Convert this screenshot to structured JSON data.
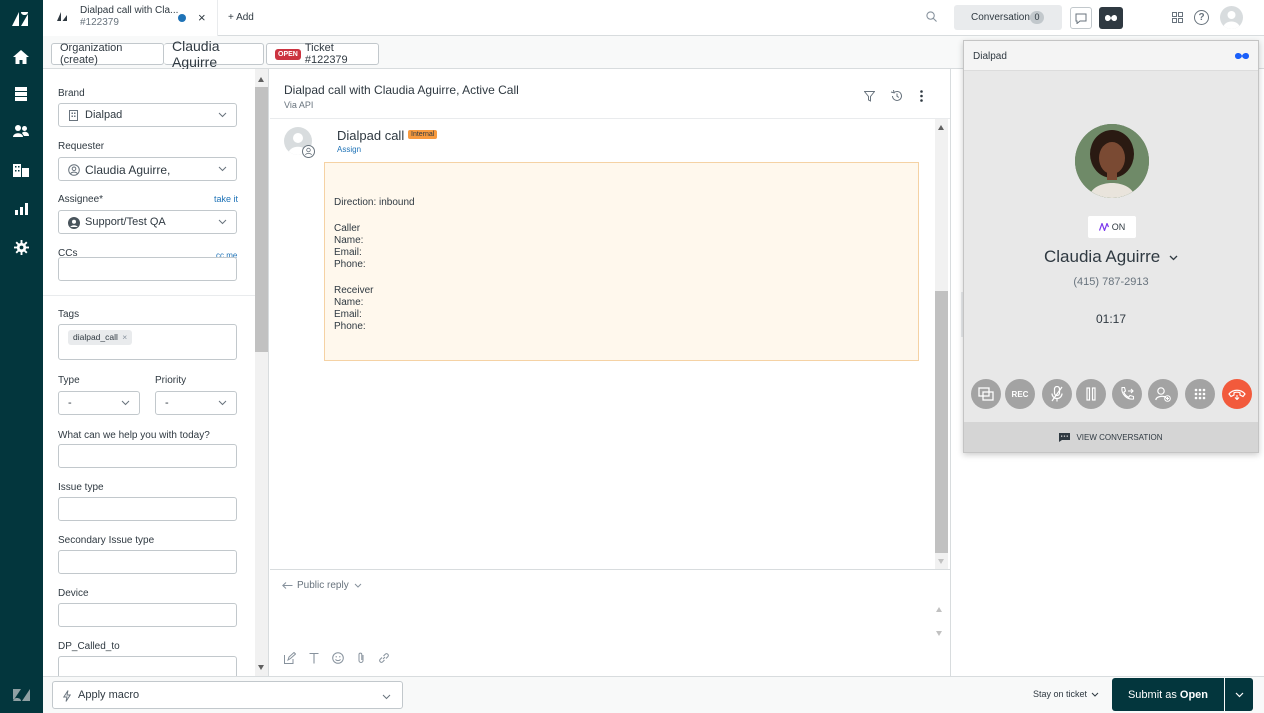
{
  "tab": {
    "title": "Dialpad call with Cla...",
    "ticket": "#122379",
    "add_label": "+ Add"
  },
  "topbar": {
    "conversations_label": "Conversations",
    "conversations_count": "0"
  },
  "breadcrumb": {
    "org": "Organization (create)",
    "person": "Claudia Aguirre",
    "status": "OPEN",
    "ticket": "Ticket #122379"
  },
  "fields": {
    "brand_label": "Brand",
    "brand_value": "Dialpad",
    "requester_label": "Requester",
    "requester_value": "Claudia Aguirre,",
    "assignee_label": "Assignee*",
    "take_it": "take it",
    "assignee_value": "Support/Test QA",
    "ccs_label": "CCs",
    "cc_me": "cc me",
    "tags_label": "Tags",
    "tag_value": "dialpad_call",
    "type_label": "Type",
    "type_value": "-",
    "priority_label": "Priority",
    "priority_value": "-",
    "help_label": "What can we help you with today?",
    "issue_label": "Issue type",
    "secondary_label": "Secondary Issue type",
    "device_label": "Device",
    "called_label": "DP_Called_to"
  },
  "conversation": {
    "title": "Dialpad call with Claudia Aguirre, Active Call",
    "via": "Via API",
    "author": "Dialpad call",
    "badge": "Internal",
    "assign": "Assign",
    "direction": "Direction: inbound",
    "caller_header": "Caller",
    "receiver_header": "Receiver",
    "name_label": "Name:",
    "email_label": "Email:",
    "phone_label": "Phone:",
    "reply_label": "Public reply"
  },
  "dialpad": {
    "header": "Dialpad",
    "ai_label": "ON",
    "caller_name": "Claudia Aguirre",
    "phone": "(415) 787-2913",
    "timer": "01:17",
    "rec_label": "REC",
    "view_conversation": "VIEW CONVERSATION"
  },
  "bottom": {
    "macro_label": "Apply macro",
    "stay_label": "Stay on ticket",
    "submit_prefix": "Submit as",
    "submit_status": "Open"
  },
  "colors": {
    "rail": "#03363d",
    "open_badge": "#cc3340",
    "internal_badge": "#f79a3e",
    "note_bg": "#fff8ed",
    "hangup": "#f25a3c",
    "submit": "#03363d"
  }
}
